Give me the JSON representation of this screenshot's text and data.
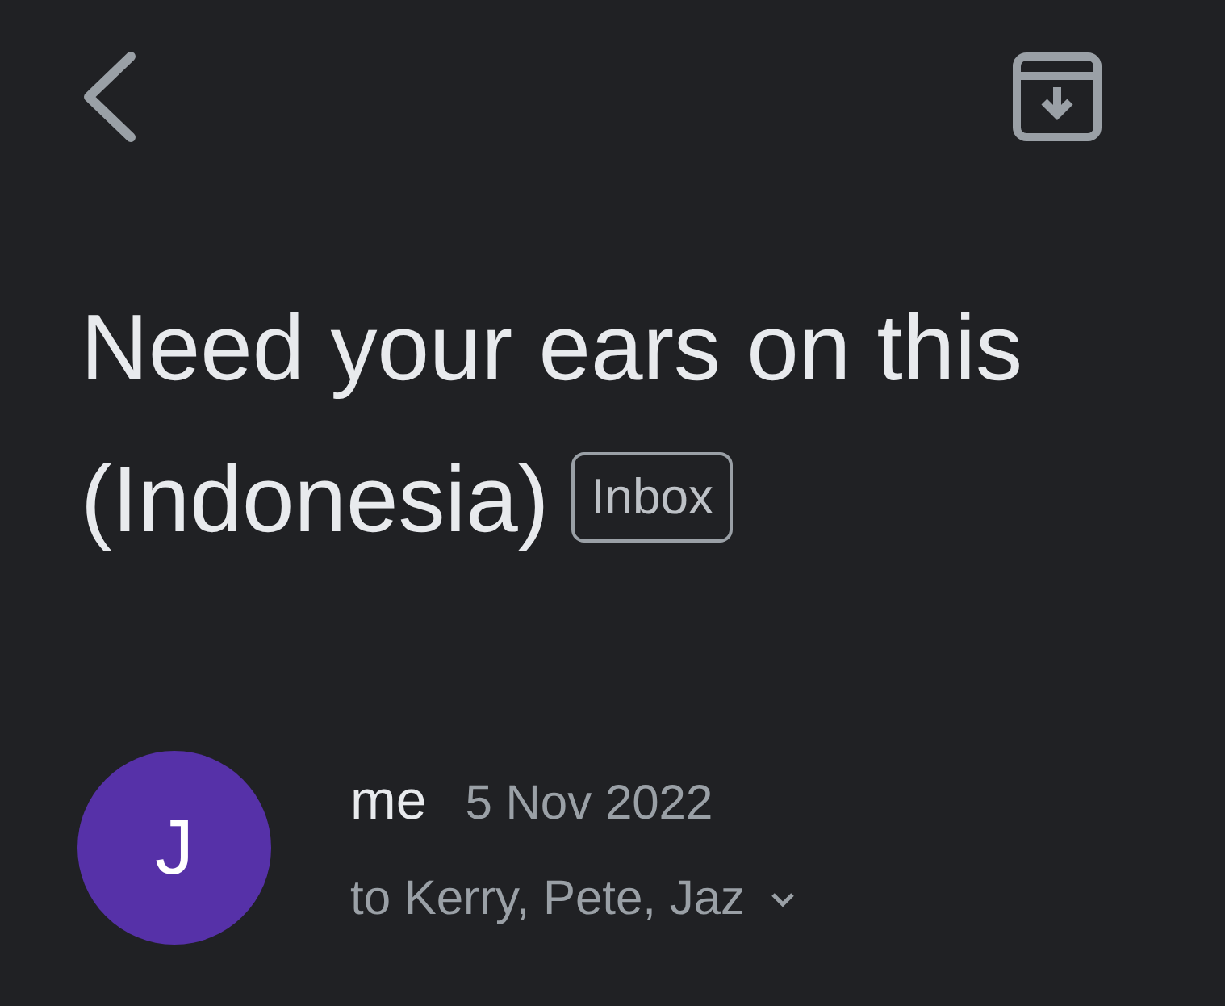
{
  "subject": {
    "title_lines": [
      "Need your ears on this",
      "(Indonesia)"
    ],
    "label": "Inbox"
  },
  "message": {
    "avatar_initial": "J",
    "sender": "me",
    "date": "5 Nov 2022",
    "recipients": "to Kerry, Pete, Jaz"
  }
}
